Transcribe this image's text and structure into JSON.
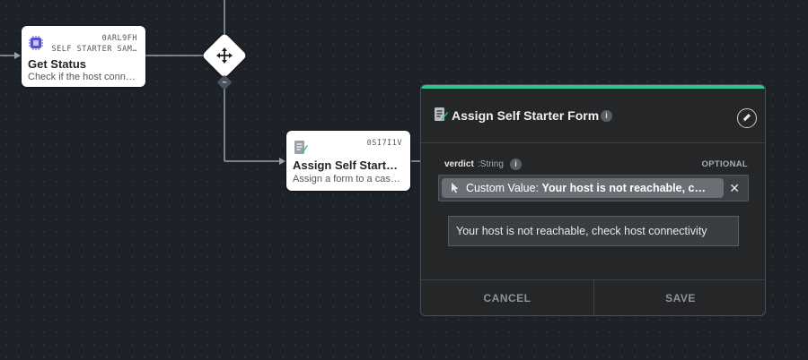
{
  "nodes": {
    "get_status": {
      "id": "0ARL9FH",
      "subtitle": "SELF STARTER SAM…",
      "title": "Get Status",
      "description": "Check if the host conn…"
    },
    "assign_form": {
      "id": "0SI7I1V",
      "title": "Assign Self Starte…",
      "description": "Assign a form to a case…"
    },
    "decision_port_label": "~"
  },
  "panel": {
    "title": "Assign Self Starter Form",
    "accent_color": "#2cc391",
    "field": {
      "name": "verdict",
      "type": ":String",
      "optional_label": "OPTIONAL",
      "chip_prefix": "Custom Value:",
      "chip_value": "Your host is not reachable, c…",
      "input_value": "Your host is not reachable, check host connectivity"
    },
    "buttons": {
      "cancel": "CANCEL",
      "save": "SAVE"
    }
  },
  "icons": {
    "get_status": "chip-icon",
    "assign_form": "form-icon",
    "decision": "move-icon",
    "edit": "pencil-icon",
    "value_source": "cursor-icon",
    "clear": "close-icon",
    "info": "info-icon"
  }
}
